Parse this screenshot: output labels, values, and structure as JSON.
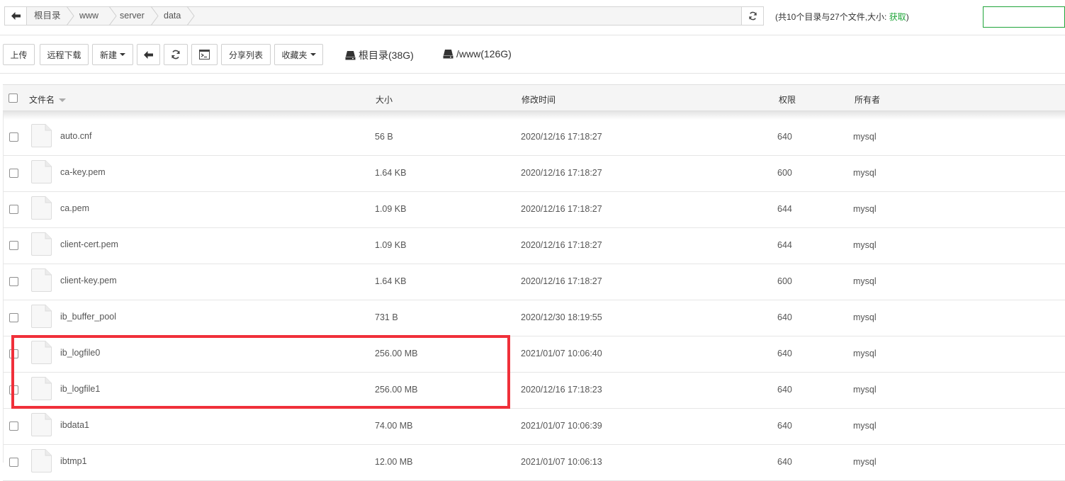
{
  "path_bar": {
    "crumbs": [
      "根目录",
      "www",
      "server",
      "data"
    ]
  },
  "summary": {
    "text": "(共10个目录与27个文件,大小:",
    "link": "获取",
    "close": ")"
  },
  "toolbar": {
    "upload": "上传",
    "remote_download": "远程下载",
    "new": "新建",
    "share_list": "分享列表",
    "favorites": "收藏夹"
  },
  "disks": [
    {
      "label": "根目录(38G)"
    },
    {
      "label": "/www(126G)"
    }
  ],
  "table": {
    "headers": {
      "name": "文件名",
      "size": "大小",
      "mtime": "修改时间",
      "perm": "权限",
      "owner": "所有者"
    },
    "rows": [
      {
        "name": "auto.cnf",
        "size": "56 B",
        "mtime": "2020/12/16 17:18:27",
        "perm": "640",
        "owner": "mysql"
      },
      {
        "name": "ca-key.pem",
        "size": "1.64 KB",
        "mtime": "2020/12/16 17:18:27",
        "perm": "600",
        "owner": "mysql"
      },
      {
        "name": "ca.pem",
        "size": "1.09 KB",
        "mtime": "2020/12/16 17:18:27",
        "perm": "644",
        "owner": "mysql"
      },
      {
        "name": "client-cert.pem",
        "size": "1.09 KB",
        "mtime": "2020/12/16 17:18:27",
        "perm": "644",
        "owner": "mysql"
      },
      {
        "name": "client-key.pem",
        "size": "1.64 KB",
        "mtime": "2020/12/16 17:18:27",
        "perm": "600",
        "owner": "mysql"
      },
      {
        "name": "ib_buffer_pool",
        "size": "731 B",
        "mtime": "2020/12/30 18:19:55",
        "perm": "640",
        "owner": "mysql"
      },
      {
        "name": "ib_logfile0",
        "size": "256.00 MB",
        "mtime": "2021/01/07 10:06:40",
        "perm": "640",
        "owner": "mysql"
      },
      {
        "name": "ib_logfile1",
        "size": "256.00 MB",
        "mtime": "2020/12/16 17:18:23",
        "perm": "640",
        "owner": "mysql"
      },
      {
        "name": "ibdata1",
        "size": "74.00 MB",
        "mtime": "2021/01/07 10:06:39",
        "perm": "640",
        "owner": "mysql"
      },
      {
        "name": "ibtmp1",
        "size": "12.00 MB",
        "mtime": "2021/01/07 10:06:13",
        "perm": "640",
        "owner": "mysql"
      }
    ]
  },
  "colors": {
    "accent": "#20a53a",
    "highlight": "#f0303a"
  }
}
